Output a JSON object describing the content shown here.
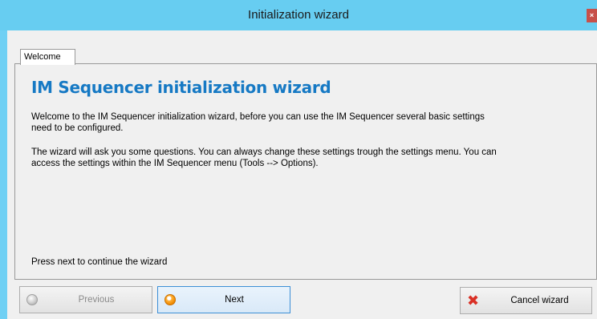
{
  "window": {
    "title": "Initialization wizard",
    "close_glyph": "×"
  },
  "tabs": [
    {
      "label": "Welcome",
      "selected": true
    }
  ],
  "content": {
    "heading": "IM Sequencer initialization wizard",
    "paragraph1": "Welcome to the IM Sequencer initialization wizard, before you can use the IM Sequencer several basic settings need to be configured.",
    "paragraph2": "The wizard will ask you some questions. You can always change these settings trough the settings menu. You can access the settings within the IM Sequencer menu (Tools --> Options).",
    "footer": "Press next to continue the wizard"
  },
  "buttons": {
    "previous": {
      "label": "Previous",
      "icon": "circle-grey-icon",
      "enabled": false
    },
    "next": {
      "label": "Next",
      "icon": "circle-orange-icon",
      "enabled": true
    },
    "cancel": {
      "label": "Cancel wizard",
      "icon": "red-x-icon",
      "enabled": true
    }
  },
  "colors": {
    "titlebar": "#67cdf1",
    "heading": "#1679c4",
    "close": "#c7504a"
  }
}
